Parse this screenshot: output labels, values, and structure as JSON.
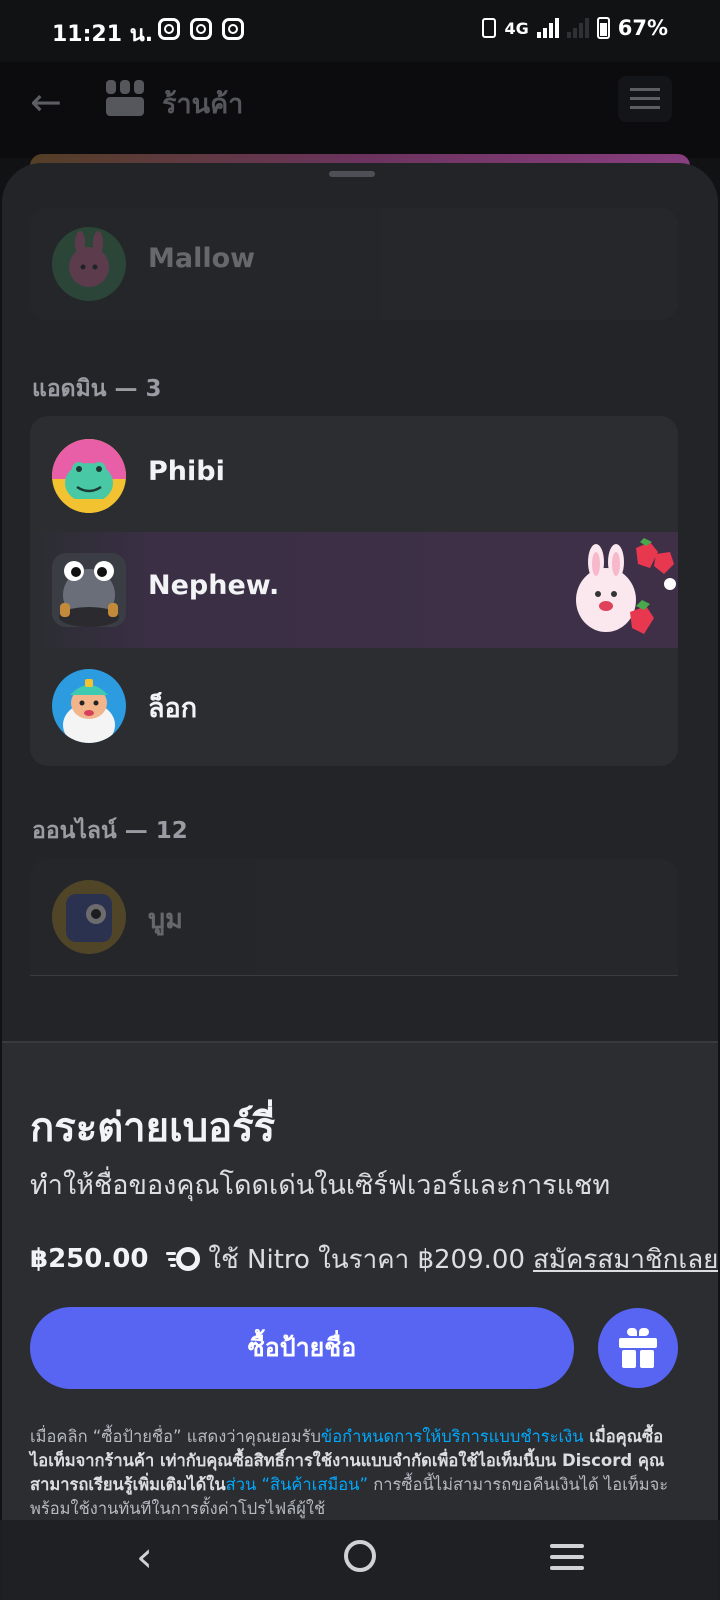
{
  "status_bar": {
    "time": "11:21 น.",
    "network": "4G",
    "battery": "67%",
    "notification_icons": [
      "instagram-icon",
      "instagram-icon",
      "instagram-icon"
    ]
  },
  "header": {
    "title": "ร้านค้า",
    "back_icon": "back-arrow-icon",
    "shop_icon": "shop-icon",
    "menu_icon": "hamburger-menu-icon"
  },
  "member_list": {
    "top_member": {
      "name": "Mallow"
    },
    "admin_section": {
      "label": "แอดมิน — 3",
      "members": [
        {
          "name": "Phibi"
        },
        {
          "name": "Nephew.",
          "decoration": "strawberry-bunny-nameplate"
        },
        {
          "name": "ล็อก"
        }
      ]
    },
    "online_section": {
      "label": "ออนไลน์ — 12",
      "members": [
        {
          "name": "บูม"
        }
      ]
    }
  },
  "product": {
    "title": "กระต่ายเบอร์รี่",
    "description": "ทำให้ชื่อของคุณโดดเด่นในเซิร์ฟเวอร์และการแชท",
    "price": "฿250.00",
    "nitro_text": "ใช้ Nitro ในราคา ฿209.00",
    "subscribe_link": "สมัครสมาชิกเลย",
    "buy_button": "ซื้อป้ายชื่อ",
    "gift_icon": "gift-icon",
    "legal": {
      "part1": "เมื่อคลิก “ซื้อป้ายชื่อ” แสดงว่าคุณยอมรับ",
      "link1": "ข้อกำหนดการให้บริการแบบชำระเงิน",
      "part2": " เมื่อคุณซื้อไอเท็มจากร้านค้า เท่ากับคุณซื้อสิทธิ์การใช้งานแบบจำกัดเพื่อใช้ไอเท็มนี้บน Discord คุณสามารถเรียนรู้เพิ่มเติมได้ใน",
      "link2": "ส่วน “สินค้าเสมือน”",
      "part3": " การซื้อนี้ไม่สามารถขอคืนเงินได้ ไอเท็มจะพร้อมใช้งานทันทีในการตั้งค่าโปรไฟล์ผู้ใช้"
    }
  },
  "colors": {
    "accent": "#5865f2",
    "background": "#2b2d31",
    "link": "#00a8fc",
    "highlight_row": "#3a2f45"
  }
}
